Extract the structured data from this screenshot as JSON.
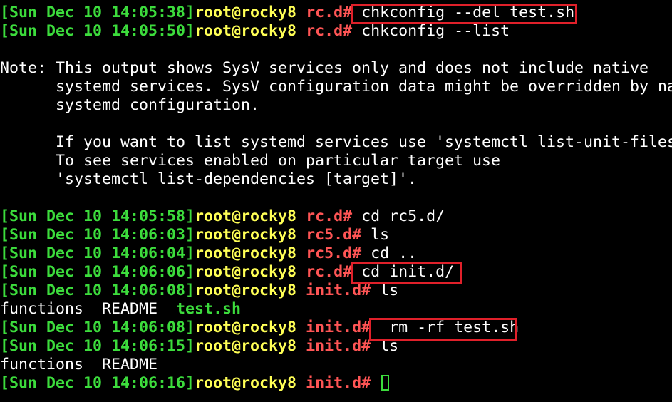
{
  "terminal": {
    "lines": [
      {
        "type": "prompt",
        "ts": "Sun Dec 10 14:05:38",
        "user": "root@rocky8",
        "dir": "rc.d#",
        "cmd": " chkconfig --del test.sh"
      },
      {
        "type": "prompt",
        "ts": "Sun Dec 10 14:05:50",
        "user": "root@rocky8",
        "dir": "rc.d#",
        "cmd": " chkconfig --list"
      },
      {
        "type": "text",
        "text": ""
      },
      {
        "type": "text",
        "text": "Note: This output shows SysV services only and does not include native"
      },
      {
        "type": "text",
        "text": "      systemd services. SysV configuration data might be overridden by na"
      },
      {
        "type": "text",
        "text": "      systemd configuration."
      },
      {
        "type": "text",
        "text": ""
      },
      {
        "type": "text",
        "text": "      If you want to list systemd services use 'systemctl list-unit-files"
      },
      {
        "type": "text",
        "text": "      To see services enabled on particular target use"
      },
      {
        "type": "text",
        "text": "      'systemctl list-dependencies [target]'."
      },
      {
        "type": "text",
        "text": ""
      },
      {
        "type": "prompt",
        "ts": "Sun Dec 10 14:05:58",
        "user": "root@rocky8",
        "dir": "rc.d#",
        "cmd": " cd rc5.d/"
      },
      {
        "type": "prompt",
        "ts": "Sun Dec 10 14:06:03",
        "user": "root@rocky8",
        "dir": "rc5.d#",
        "cmd": " ls"
      },
      {
        "type": "prompt",
        "ts": "Sun Dec 10 14:06:04",
        "user": "root@rocky8",
        "dir": "rc5.d#",
        "cmd": " cd .."
      },
      {
        "type": "prompt",
        "ts": "Sun Dec 10 14:06:06",
        "user": "root@rocky8",
        "dir": "rc.d#",
        "cmd": " cd init.d/"
      },
      {
        "type": "prompt",
        "ts": "Sun Dec 10 14:06:08",
        "user": "root@rocky8",
        "dir": "init.d#",
        "cmd": " ls"
      },
      {
        "type": "listing",
        "items": [
          "functions",
          "README"
        ],
        "exec": "test.sh"
      },
      {
        "type": "prompt",
        "ts": "Sun Dec 10 14:06:08",
        "user": "root@rocky8",
        "dir": "init.d#",
        "cmd": "  rm -rf test.sh"
      },
      {
        "type": "prompt",
        "ts": "Sun Dec 10 14:06:15",
        "user": "root@rocky8",
        "dir": "init.d#",
        "cmd": " ls"
      },
      {
        "type": "text",
        "text": "functions  README"
      },
      {
        "type": "prompt",
        "ts": "Sun Dec 10 14:06:16",
        "user": "root@rocky8",
        "dir": "init.d#",
        "cmd": " ",
        "cursor": true
      }
    ]
  },
  "colors": {
    "background": "#000000",
    "timestamp": "#3cdc3c",
    "user": "#ffff55",
    "directory": "#ff5555",
    "highlight_box": "#e0202a"
  }
}
